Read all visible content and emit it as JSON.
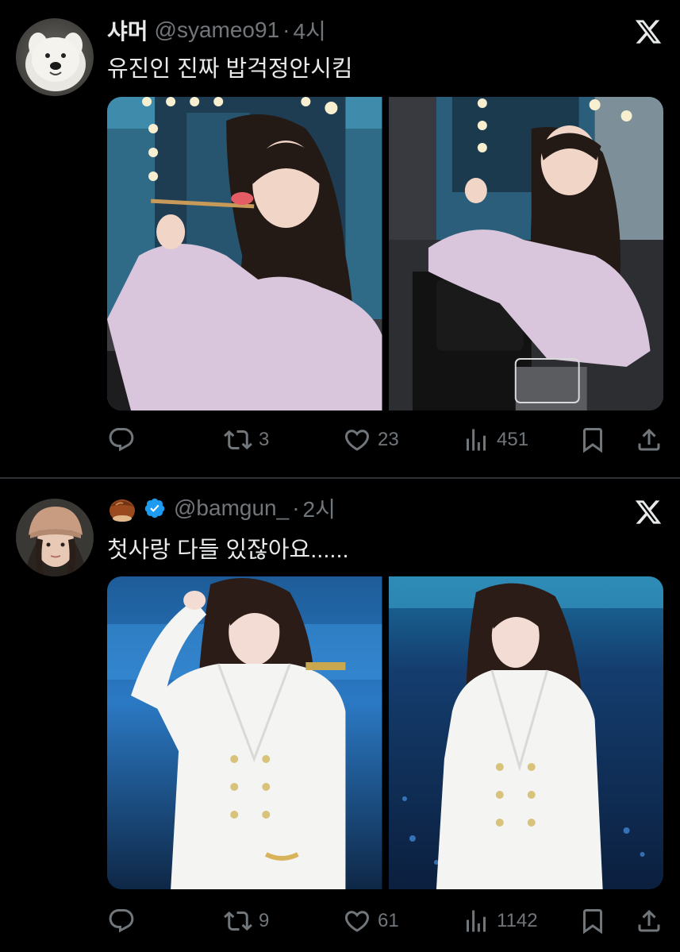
{
  "tweets": [
    {
      "display_name": "샤머",
      "handle": "@syameo91",
      "separator": "·",
      "time": "4시",
      "text": "유진인 진짜 밥걱정안시킴",
      "avatar_icon": "white-dog-avatar",
      "verified": false,
      "stats": {
        "replies": "",
        "retweets": "3",
        "likes": "23",
        "views": "451"
      }
    },
    {
      "display_name_emoji": "chestnut-emoji",
      "handle": "@bamgun_",
      "separator": "·",
      "time": "2시",
      "text": "첫사랑 다들 있잖아요......",
      "avatar_icon": "girl-beanie-avatar",
      "verified": true,
      "stats": {
        "replies": "",
        "retweets": "9",
        "likes": "61",
        "views": "1142"
      }
    }
  ],
  "colors": {
    "background": "#000000",
    "text_primary": "#e7e9ea",
    "text_secondary": "#71767b",
    "divider": "#2f3336",
    "verified_blue": "#1d9bf0"
  }
}
